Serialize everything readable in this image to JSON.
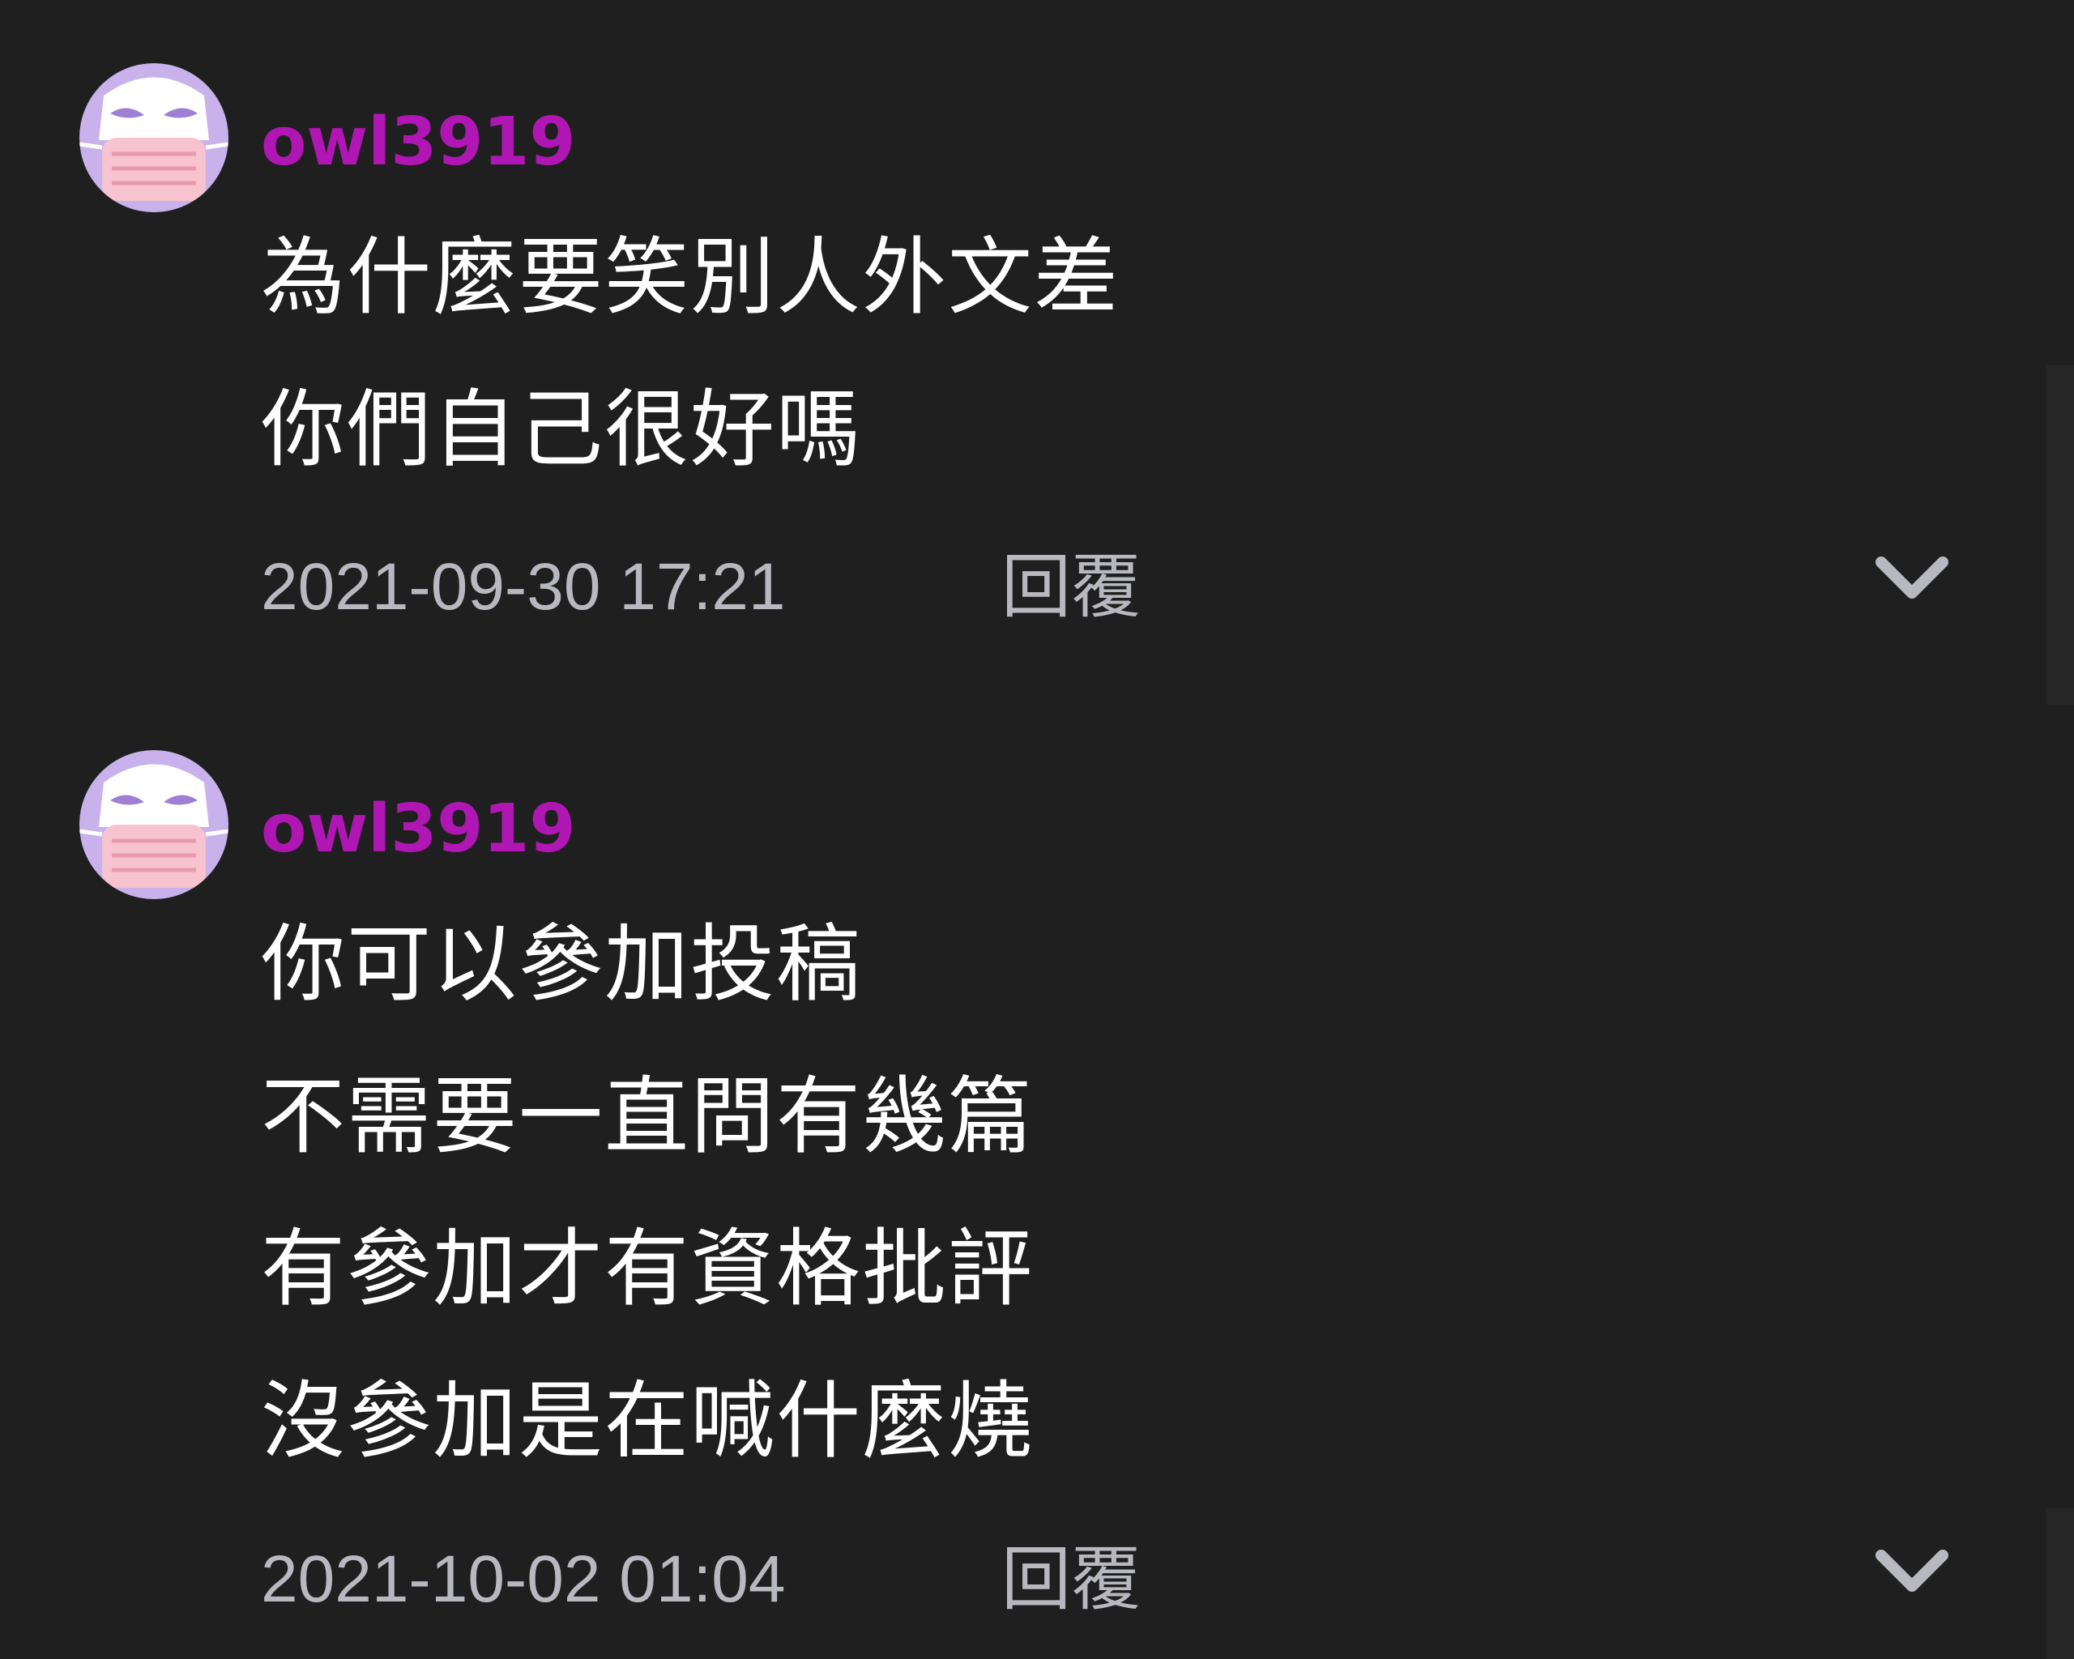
{
  "theme": {
    "background": "#1f1f1f",
    "username_color": "#b016b3",
    "meta_color": "#b8b8c0",
    "text_color": "#ffffff",
    "avatar_color": "#c9b2ec"
  },
  "comments": [
    {
      "avatar_icon": "owl-mask-avatar-icon",
      "username": "owl3919",
      "lines": [
        "為什麼要笑別人外文差",
        "你們自己很好嗎"
      ],
      "timestamp": "2021-09-30 17:21",
      "reply_label": "回覆",
      "menu_icon": "chevron-down-icon"
    },
    {
      "avatar_icon": "owl-mask-avatar-icon",
      "username": "owl3919",
      "lines": [
        "你可以參加投稿",
        "不需要一直問有幾篇",
        "有參加才有資格批評",
        "沒參加是在喊什麼燒"
      ],
      "timestamp": "2021-10-02 01:04",
      "reply_label": "回覆",
      "menu_icon": "chevron-down-icon"
    }
  ]
}
